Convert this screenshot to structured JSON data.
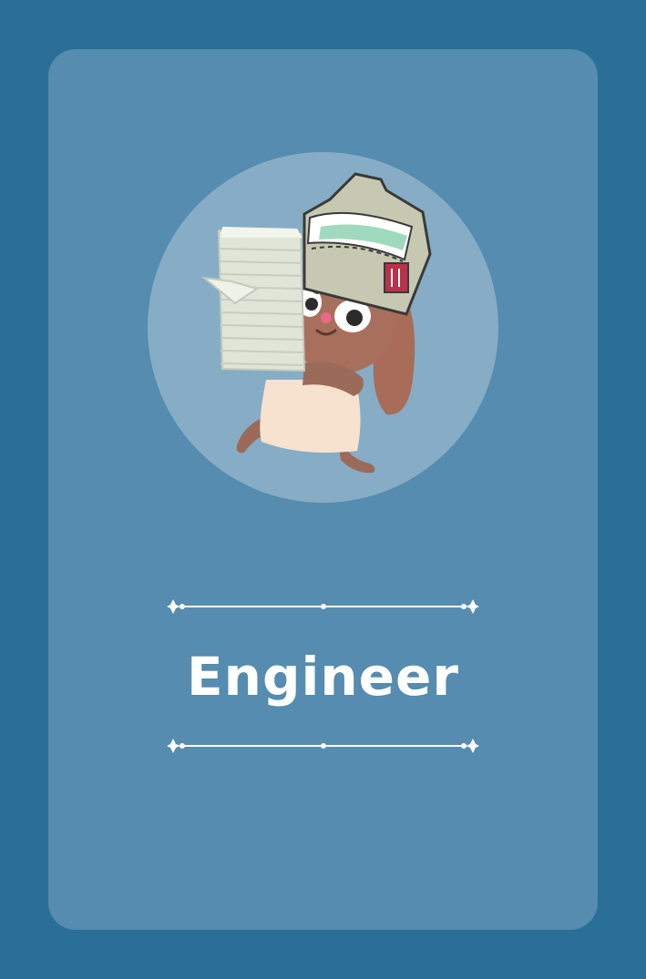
{
  "card": {
    "title": "Engineer",
    "illustration_icon": "bunny-carrying-papers-icon"
  },
  "colors": {
    "background": "#2a6f98",
    "card": "#558caf",
    "avatar_circle": "#86adc5",
    "title_text": "#ffffff",
    "divider": "#ffffff"
  }
}
